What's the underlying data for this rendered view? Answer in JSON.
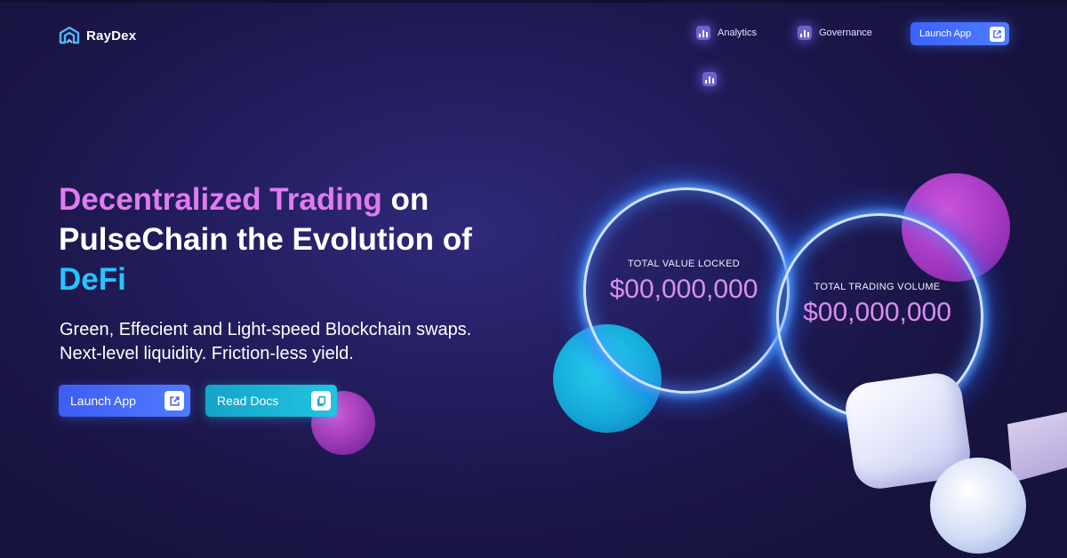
{
  "brand": {
    "name": "RayDex",
    "accent": "#4f7bff"
  },
  "nav": {
    "items": [
      {
        "label": "Analytics",
        "icon": "bar-chart-icon"
      },
      {
        "label": "Governance",
        "icon": "bar-chart-icon"
      }
    ],
    "launch_label": "Launch App"
  },
  "hero": {
    "title_part1": "Decentralized Trading",
    "title_part2": " on PulseChain the Evolution of ",
    "title_part3": "DeFi",
    "subtitle_line1": "Green, Effecient and Light-speed Blockchain swaps.",
    "subtitle_line2": "Next-level liquidity. Friction-less yield.",
    "launch_label": "Launch App",
    "docs_label": "Read Docs"
  },
  "stats": {
    "tvl": {
      "label": "TOTAL VALUE LOCKED",
      "value": "$00,000,000"
    },
    "volume": {
      "label": "TOTAL TRADING VOLUME",
      "value": "$00,000,000"
    }
  },
  "colors": {
    "pink": "#e07bf2",
    "cyan": "#25c5ff",
    "background": "#1b1648"
  }
}
